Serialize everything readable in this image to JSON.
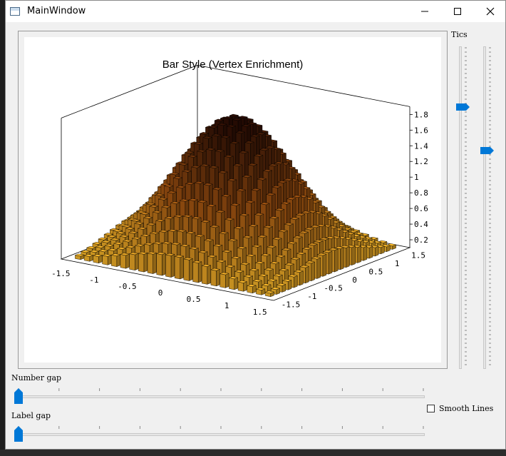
{
  "window": {
    "title": "MainWindow"
  },
  "plot": {
    "title": "Bar Style (Vertex Enrichment)",
    "z_ticks": [
      "0.2",
      "0.4",
      "0.6",
      "0.8",
      "1",
      "1.2",
      "1.4",
      "1.6",
      "1.8"
    ],
    "x_ticks": [
      "-1.5",
      "-1",
      "-0.5",
      "0",
      "0.5",
      "1",
      "1.5"
    ],
    "y_ticks": [
      "1.5",
      "1",
      "0.5",
      "0",
      "-0.5",
      "-1",
      "-1.5"
    ],
    "bar_colors": {
      "low": "#f5b82a",
      "mid": "#9a4f10",
      "high": "#2a0c04"
    }
  },
  "controls": {
    "tics_label": "Tics",
    "tics_slider_1_value": 0.18,
    "tics_slider_2_value": 0.32,
    "number_gap_label": "Number gap",
    "number_gap_value": 0,
    "label_gap_label": "Label gap",
    "label_gap_value": 0,
    "smooth_lines_label": "Smooth Lines",
    "smooth_lines_checked": false
  },
  "accent_color": "#0078d7"
}
